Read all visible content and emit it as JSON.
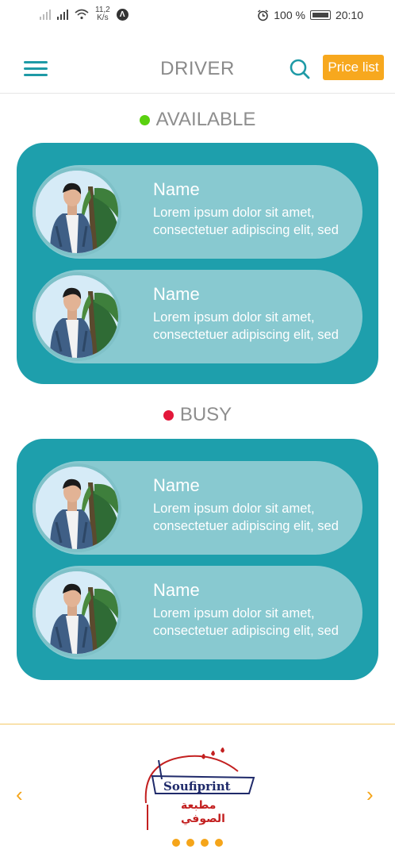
{
  "status_bar": {
    "net_speed_value": "11,2",
    "net_speed_unit": "K/s",
    "notif_glyph": "Λ",
    "battery_percent": "100 %",
    "time": "20:10",
    "icons": [
      "signal-icon",
      "wifi-icon",
      "alarm-icon",
      "battery-icon"
    ]
  },
  "header": {
    "title": "DRIVER",
    "price_button_label": "Price list",
    "accent_color": "#1e9aa6",
    "button_color": "#f7a81e"
  },
  "sections": [
    {
      "heading": "AVAILABLE",
      "status_color": "#5ad10f",
      "drivers": [
        {
          "name": "Name",
          "description": "Lorem ipsum dolor sit amet, consectetuer adipiscing elit, sed"
        },
        {
          "name": "Name",
          "description": "Lorem ipsum dolor sit amet, consectetuer adipiscing elit, sed"
        }
      ]
    },
    {
      "heading": "BUSY",
      "status_color": "#e3173a",
      "drivers": [
        {
          "name": "Name",
          "description": "Lorem ipsum dolor sit amet, consectetuer adipiscing elit, sed"
        },
        {
          "name": "Name",
          "description": "Lorem ipsum dolor sit amet, consectetuer adipiscing elit, sed"
        }
      ]
    }
  ],
  "footer": {
    "logo_text_en": "Soufiprint",
    "logo_text_ar": "مطبعة الصوفي",
    "prev_glyph": "‹",
    "next_glyph": "›",
    "page_count": 4
  }
}
